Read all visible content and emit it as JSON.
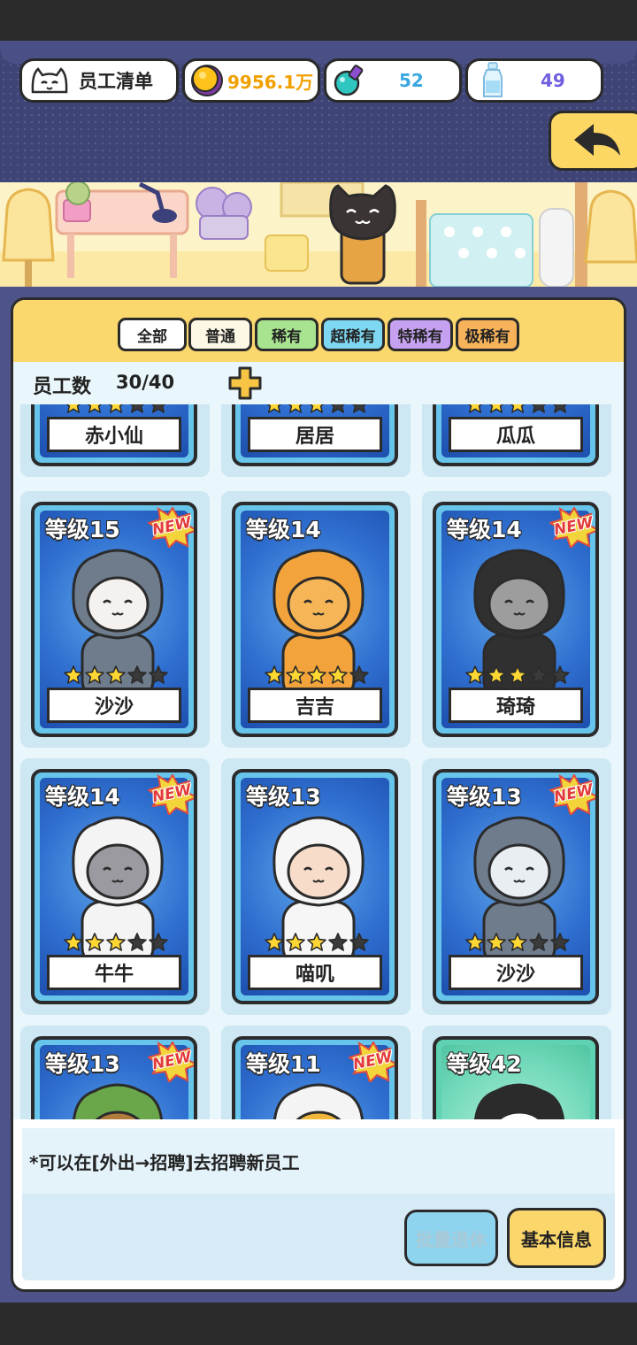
{
  "header": {
    "title": "员工清单",
    "gold": "9956.1万",
    "potion": "52",
    "bottle": "49"
  },
  "tabs": [
    {
      "label": "全部",
      "color": "#ffffff"
    },
    {
      "label": "普通",
      "color": "#fdf8e6"
    },
    {
      "label": "稀有",
      "color": "#a8e48f"
    },
    {
      "label": "超稀有",
      "color": "#7fd8f2"
    },
    {
      "label": "特稀有",
      "color": "#c6a1f2"
    },
    {
      "label": "极稀有",
      "color": "#f7b35a"
    }
  ],
  "employee_count": {
    "label": "员工数",
    "value": "30/40"
  },
  "partial_top": [
    "赤小仙",
    "居居",
    "瓜瓜"
  ],
  "cards": [
    {
      "level": "等级15",
      "name": "沙沙",
      "stars": 3,
      "new": true,
      "costume": "shark",
      "hood": "#6f7c8c",
      "face": "#f4f1ee"
    },
    {
      "level": "等级14",
      "name": "吉吉",
      "stars": 4,
      "new": false,
      "costume": "chick",
      "hood": "#f2a33b",
      "face": "#f6b658"
    },
    {
      "level": "等级14",
      "name": "琦琦",
      "stars": 3,
      "new": true,
      "costume": "penguin",
      "hood": "#303030",
      "face": "#9d9d9d"
    },
    {
      "level": "等级14",
      "name": "牛牛",
      "stars": 3,
      "new": true,
      "costume": "cow",
      "hood": "#f4f4f4",
      "face": "#9a9aa0"
    },
    {
      "level": "等级13",
      "name": "喵叽",
      "stars": 3,
      "new": false,
      "costume": "samurai",
      "hood": "#f6f6f6",
      "face": "#f6dcc9"
    },
    {
      "level": "等级13",
      "name": "沙沙",
      "stars": 3,
      "new": true,
      "costume": "shark",
      "hood": "#6f7c8c",
      "face": "#e9eef3"
    }
  ],
  "partial_bottom": [
    {
      "level": "等级13",
      "new": true,
      "rarity": "blue",
      "hood": "#6aa74a",
      "face": "#b07a3b"
    },
    {
      "level": "等级11",
      "new": true,
      "rarity": "blue",
      "hood": "#f4f4f4",
      "face": "#f0b73b"
    },
    {
      "level": "等级42",
      "new": false,
      "rarity": "green",
      "hood": "#2b2b2b",
      "face": "#ffffff"
    }
  ],
  "new_badge": "NEW",
  "hint": "*可以在[外出→招聘]去招聘新员工",
  "buttons": {
    "retire": "批量退休",
    "info": "基本信息"
  }
}
